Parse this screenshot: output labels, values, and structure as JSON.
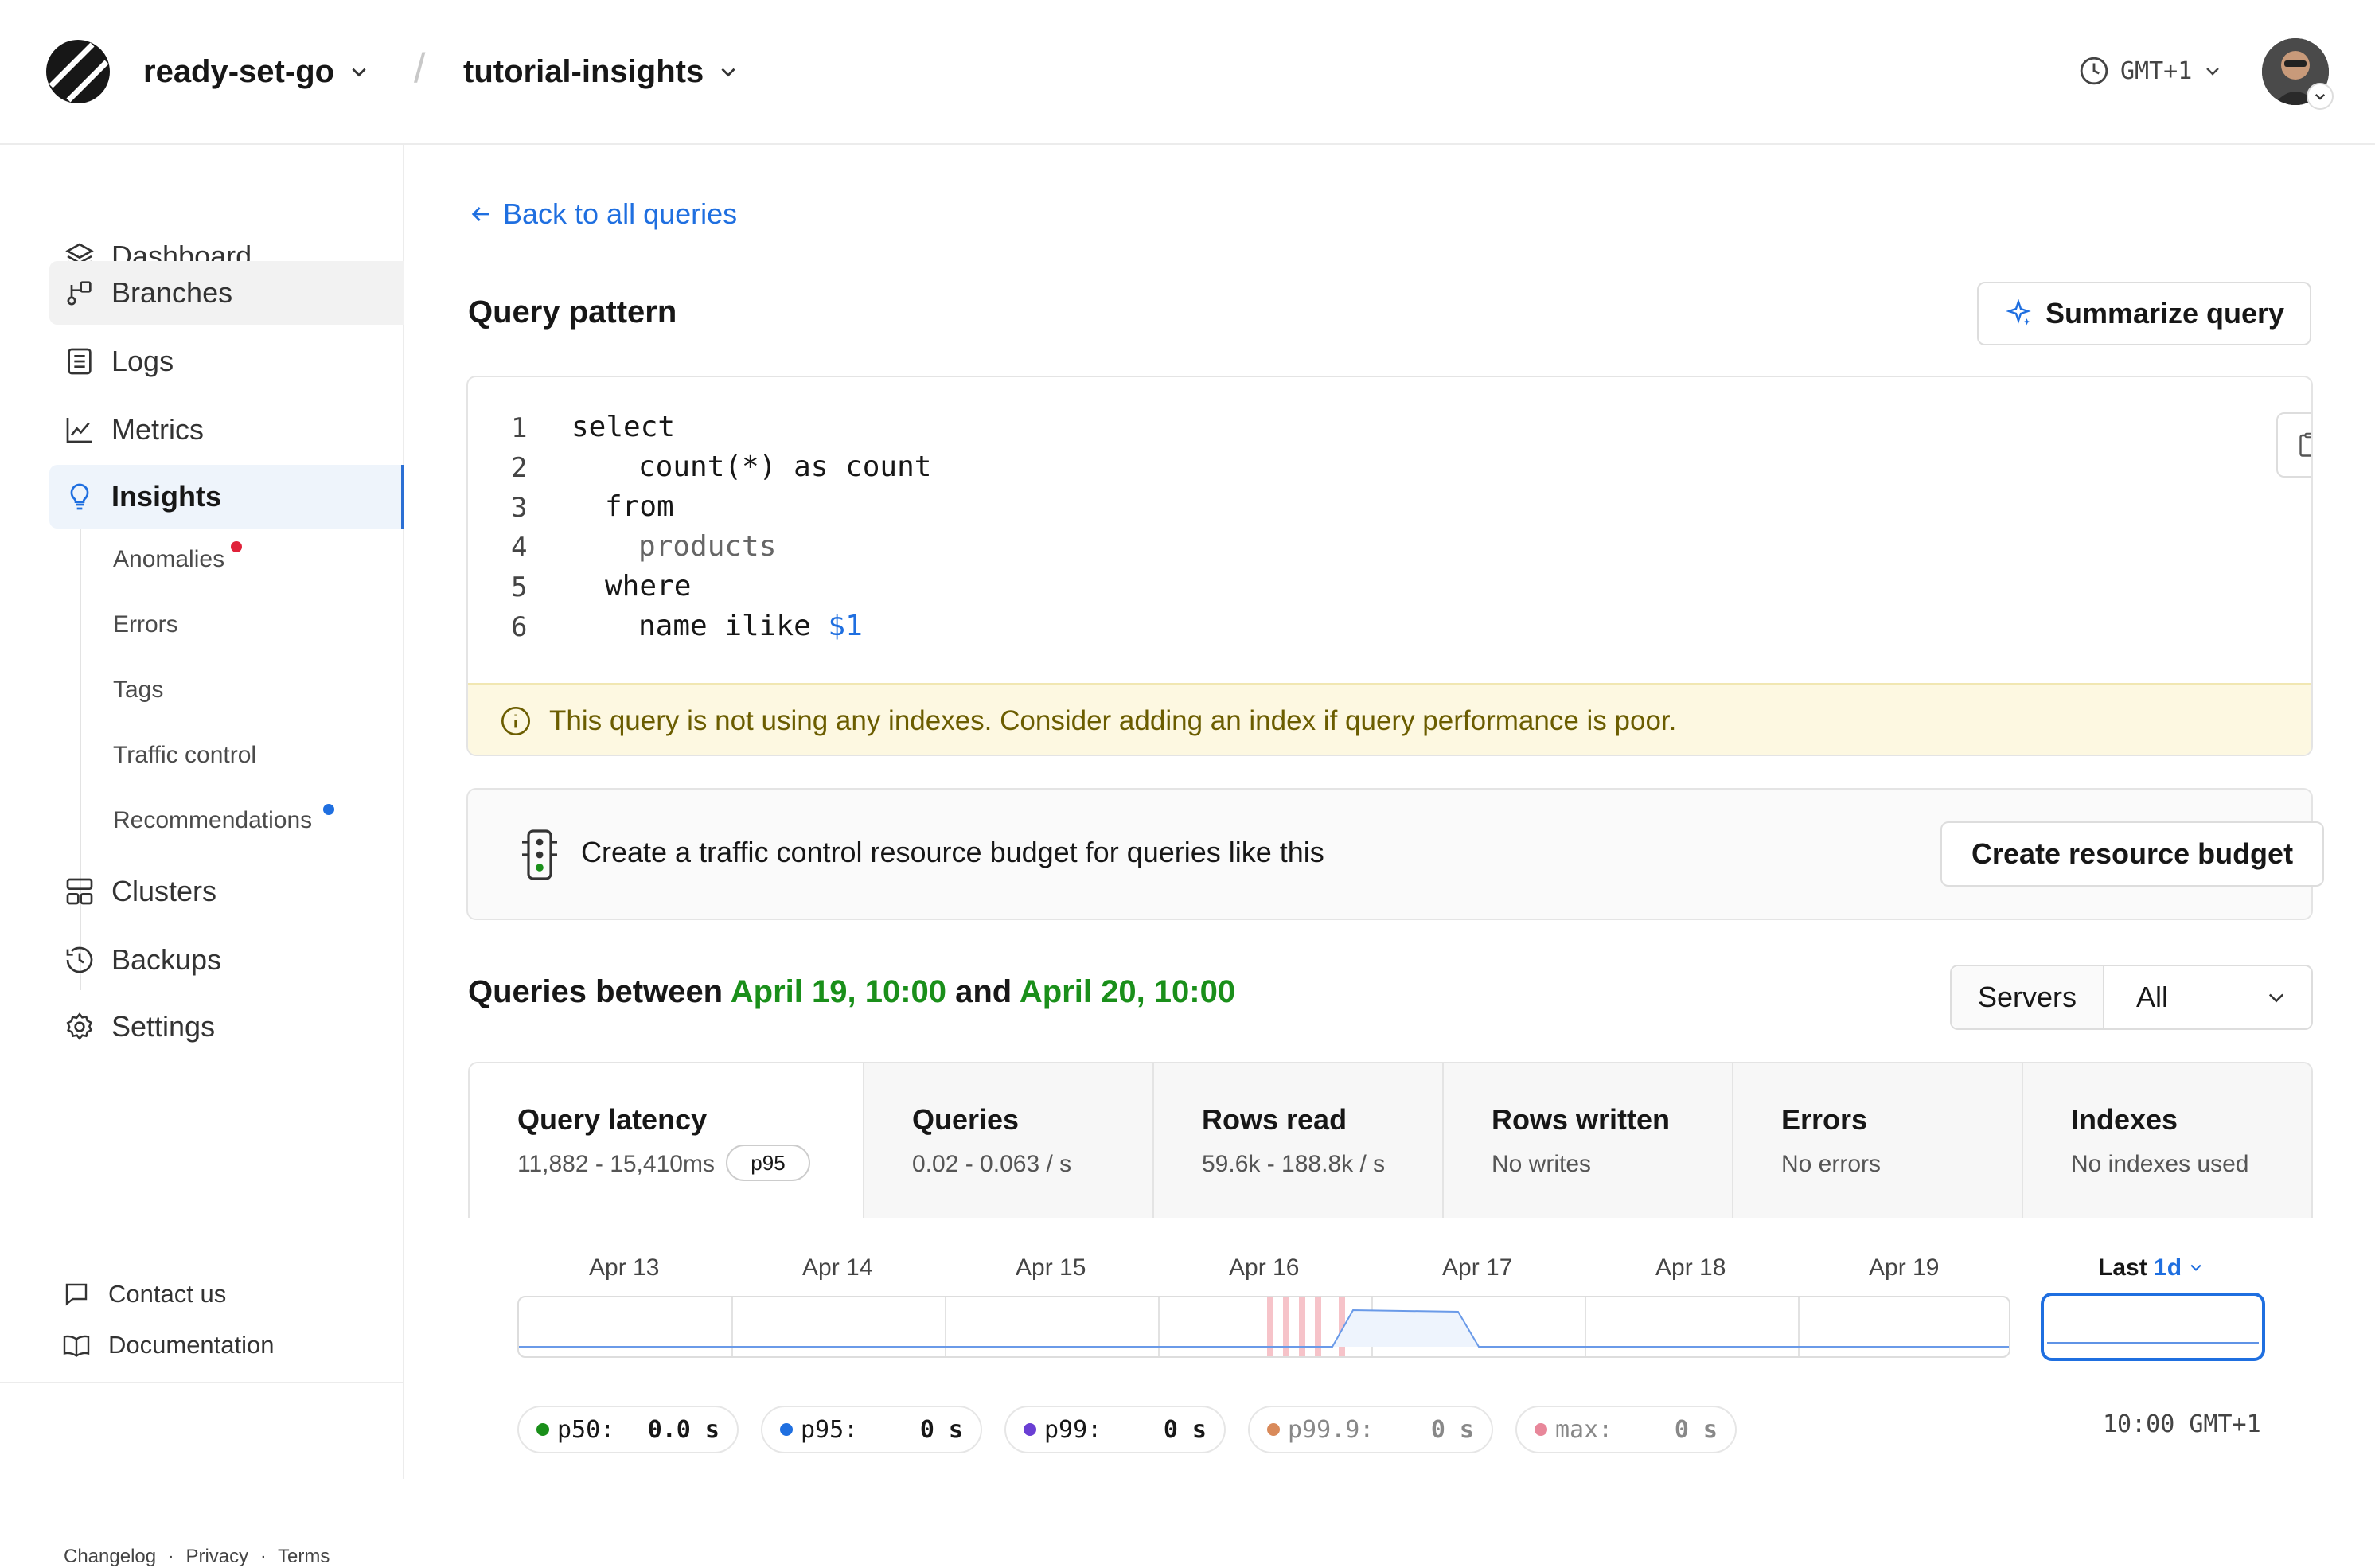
{
  "topbar": {
    "org": "ready-set-go",
    "separator": "/",
    "database": "tutorial-insights",
    "timezone": "GMT+1"
  },
  "sidebar": {
    "items": [
      {
        "label": "Dashboard",
        "icon": "layers-icon"
      },
      {
        "label": "Branches",
        "icon": "branch-icon"
      },
      {
        "label": "Logs",
        "icon": "logs-icon"
      },
      {
        "label": "Metrics",
        "icon": "chart-icon"
      },
      {
        "label": "Insights",
        "icon": "lightbulb-icon"
      },
      {
        "label": "Clusters",
        "icon": "clusters-icon"
      },
      {
        "label": "Backups",
        "icon": "backup-clock-icon"
      },
      {
        "label": "Settings",
        "icon": "gear-icon"
      }
    ],
    "insights_sub": [
      "Anomalies",
      "Errors",
      "Tags",
      "Traffic control",
      "Recommendations"
    ],
    "footer": {
      "contact": "Contact us",
      "docs": "Documentation",
      "changelog": "Changelog",
      "privacy": "Privacy",
      "terms": "Terms",
      "dot": "·"
    }
  },
  "main": {
    "back_link": "Back to all queries",
    "query_pattern_title": "Query pattern",
    "summarize_button": "Summarize query",
    "code": {
      "line_numbers": [
        "1",
        "2",
        "3",
        "4",
        "5",
        "6"
      ],
      "l1": "select",
      "l2": "count(*) as count",
      "l3": "from",
      "l4": "products",
      "l5": "where",
      "l6a": "name ilike ",
      "l6b": "$1"
    },
    "warning": "This query is not using any indexes. Consider adding an index if query performance is poor.",
    "budget_text": "Create a traffic control resource budget for queries like this",
    "budget_button": "Create resource budget",
    "queries_between": {
      "prefix": "Queries between ",
      "start": "April 19, 10:00",
      "mid": " and ",
      "end": "April 20, 10:00"
    },
    "servers": {
      "label": "Servers",
      "value": "All"
    },
    "tabs": [
      {
        "title": "Query latency",
        "value": "11,882 - 15,410ms",
        "badge": "p95"
      },
      {
        "title": "Queries",
        "value": "0.02 - 0.063 / s"
      },
      {
        "title": "Rows read",
        "value": "59.6k - 188.8k / s"
      },
      {
        "title": "Rows written",
        "value": "No writes"
      },
      {
        "title": "Errors",
        "value": "No errors"
      },
      {
        "title": "Indexes",
        "value": "No indexes used"
      }
    ],
    "timeline": {
      "dates": [
        "Apr 13",
        "Apr 14",
        "Apr 15",
        "Apr 16",
        "Apr 17",
        "Apr 18",
        "Apr 19"
      ],
      "range_prefix": "Last ",
      "range_value": "1d"
    },
    "percentiles": [
      {
        "label": "p50:",
        "value": "0.0 s",
        "color": "#1a8f1a"
      },
      {
        "label": "p95:",
        "value": "0 s",
        "color": "#1f6fe0"
      },
      {
        "label": "p99:",
        "value": "0 s",
        "color": "#6a3fd4"
      },
      {
        "label": "p99.9:",
        "value": "0 s",
        "color": "#d98a5a"
      },
      {
        "label": "max:",
        "value": "0 s",
        "color": "#e8879a"
      }
    ],
    "time_right": "10:00 GMT+1"
  },
  "colors": {
    "accent": "#1f6fe0",
    "green": "#1a8f1a",
    "warning_bg": "#fdf8e1",
    "anomaly_dot": "#e0223a",
    "recommend_dot": "#1f6fe0"
  }
}
